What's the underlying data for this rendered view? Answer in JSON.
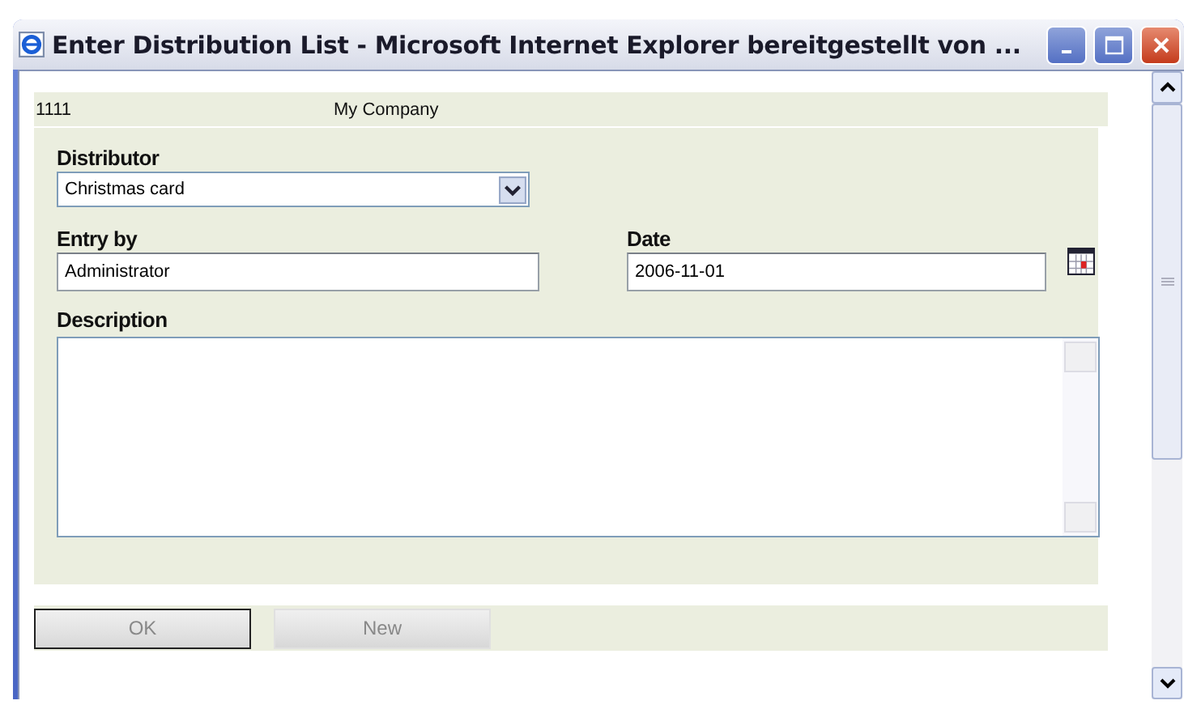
{
  "window": {
    "title": "Enter Distribution List - Microsoft Internet Explorer bereitgestellt von ..."
  },
  "header": {
    "number": "1111",
    "company": "My Company"
  },
  "form": {
    "distributor": {
      "label": "Distributor",
      "value": "Christmas card"
    },
    "entry_by": {
      "label": "Entry by",
      "value": "Administrator"
    },
    "date": {
      "label": "Date",
      "value": "2006-11-01"
    },
    "description": {
      "label": "Description"
    }
  },
  "buttons": [
    {
      "label": "OK",
      "disabled": true,
      "default": true
    },
    {
      "label": "New",
      "disabled": true,
      "default": false
    }
  ]
}
